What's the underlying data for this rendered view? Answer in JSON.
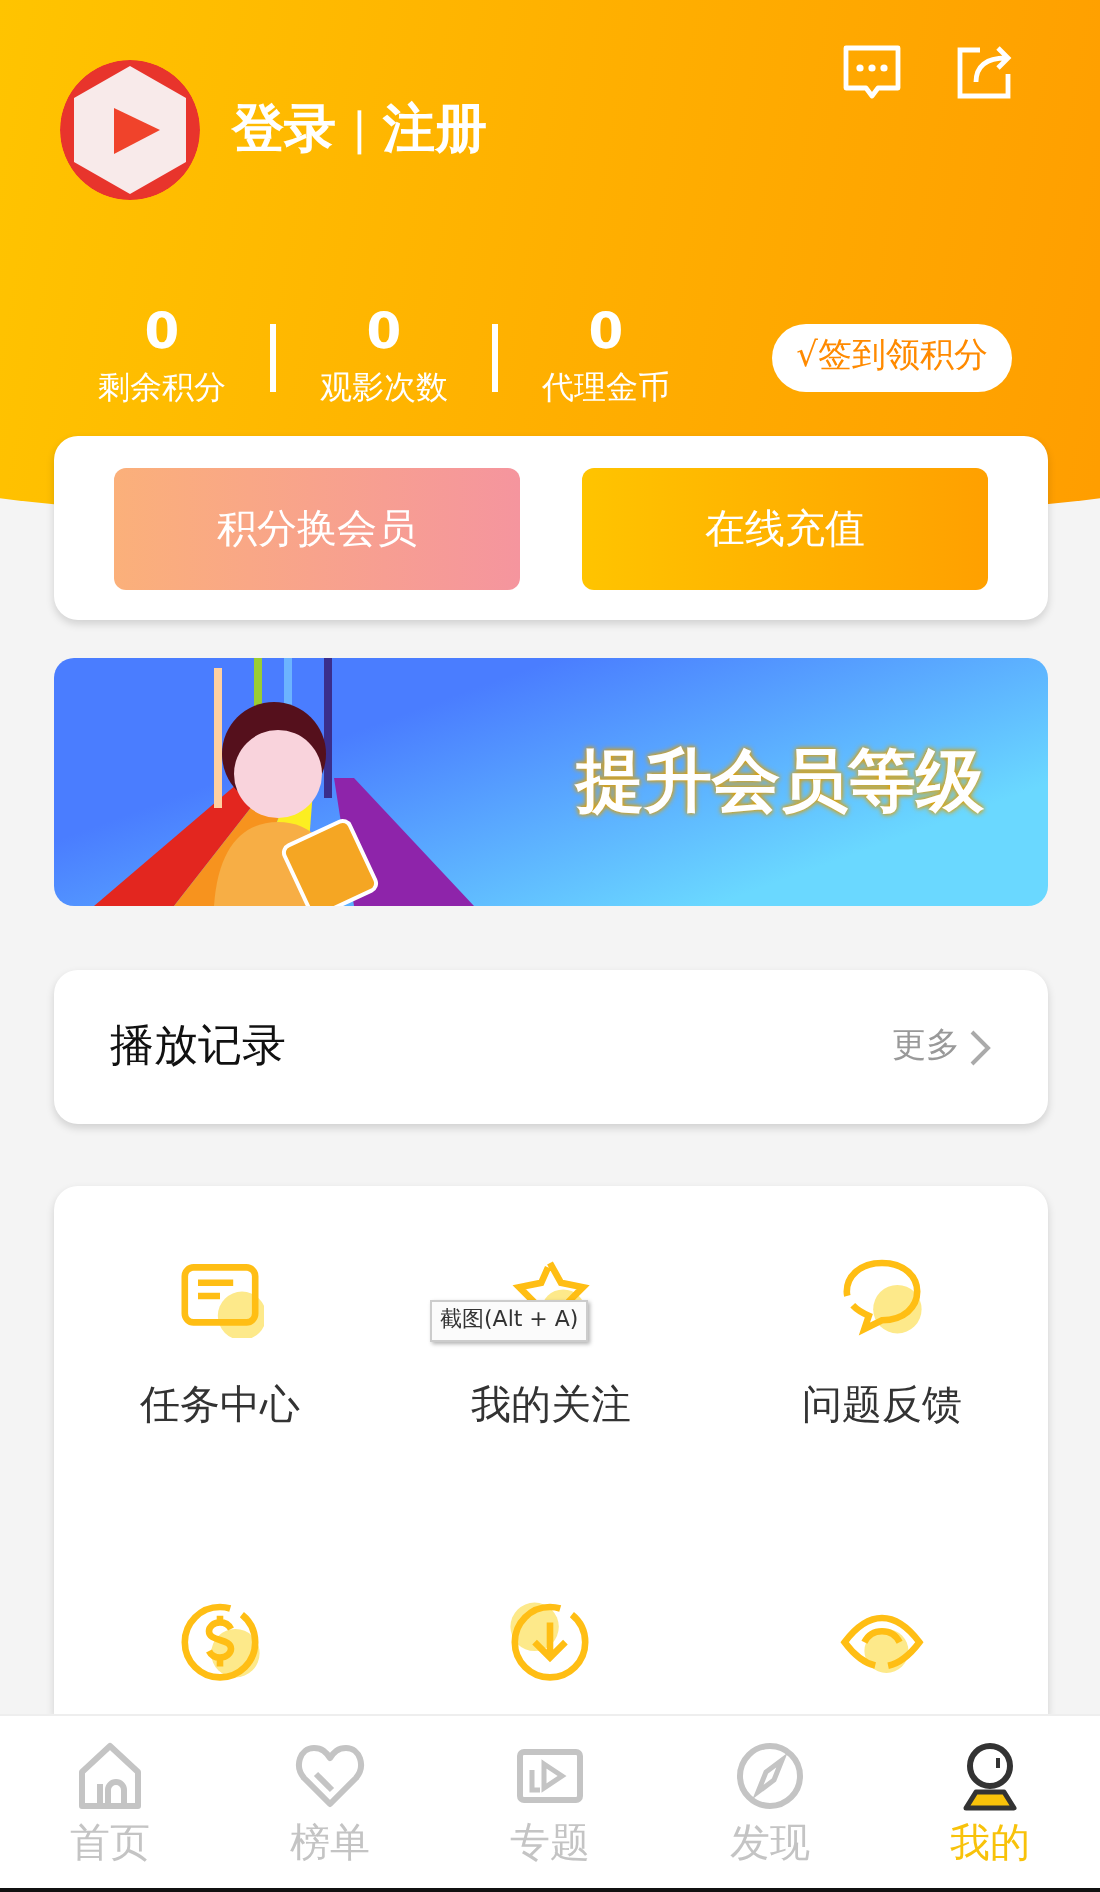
{
  "header": {
    "login": "登录",
    "separator": "|",
    "register": "注册"
  },
  "stats": [
    {
      "value": "0",
      "label": "剩余积分"
    },
    {
      "value": "0",
      "label": "观影次数"
    },
    {
      "value": "0",
      "label": "代理金币"
    }
  ],
  "checkin_button": "√签到领积分",
  "actions": [
    {
      "label": "积分换会员",
      "kind": "points"
    },
    {
      "label": "在线充值",
      "kind": "recharge"
    }
  ],
  "banner": {
    "text": "提升会员等级"
  },
  "history": {
    "title": "播放记录",
    "more": "更多"
  },
  "menu": [
    {
      "label": "任务中心",
      "kind": "card"
    },
    {
      "label": "我的关注",
      "kind": "star"
    },
    {
      "label": "问题反馈",
      "kind": "chat"
    },
    {
      "kind": "coin"
    },
    {
      "kind": "download"
    },
    {
      "kind": "eye"
    }
  ],
  "tooltip": "截图(Alt + A)",
  "tabs": [
    {
      "label": "首页",
      "kind": "home",
      "selected": false
    },
    {
      "label": "榜单",
      "kind": "heart",
      "selected": false
    },
    {
      "label": "专题",
      "kind": "video",
      "selected": false
    },
    {
      "label": "发现",
      "kind": "compass",
      "selected": false
    },
    {
      "label": "我的",
      "kind": "user",
      "selected": true
    }
  ]
}
